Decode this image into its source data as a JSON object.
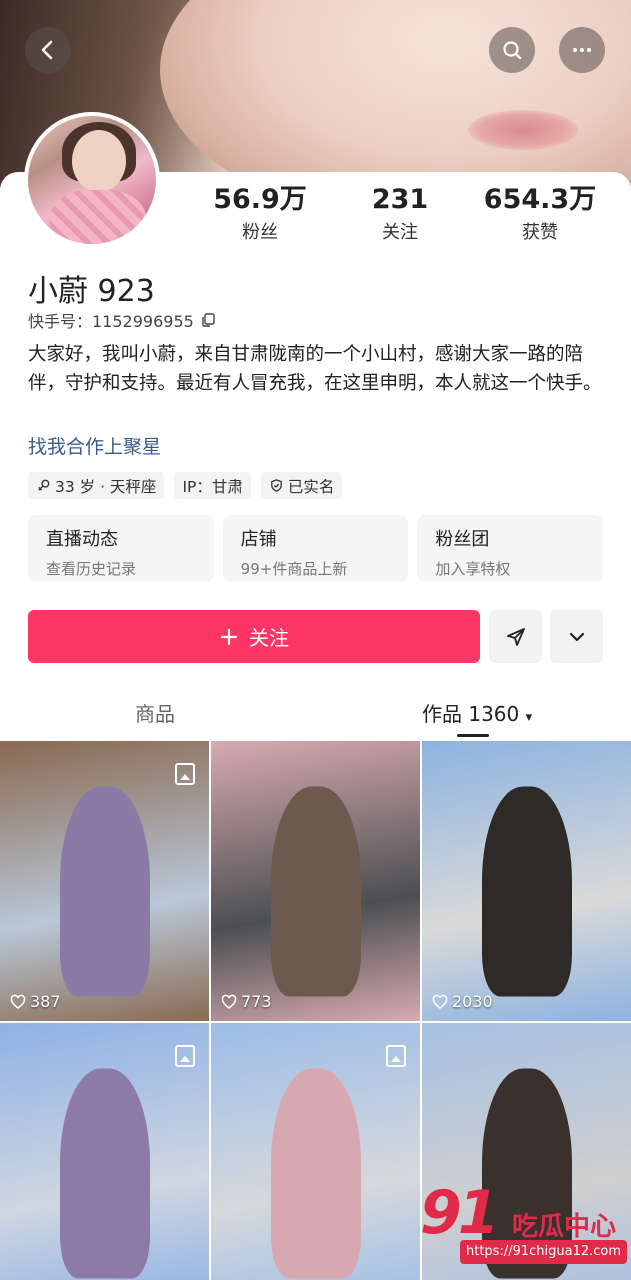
{
  "profile": {
    "stats": [
      {
        "num": "56.9万",
        "label": "粉丝"
      },
      {
        "num": "231",
        "label": "关注"
      },
      {
        "num": "654.3万",
        "label": "获赞"
      }
    ],
    "name": "小蔚 923",
    "uid_label": "快手号：1152996955",
    "bio": "大家好，我叫小蔚，来自甘肃陇南的一个小山村，感谢大家一路的陪伴，守护和支持。最近有人冒充我，在这里申明，本人就这一个快手。",
    "link": "找我合作上聚星",
    "tags": [
      "33 岁 · 天秤座",
      "IP：甘肃",
      "已实名"
    ]
  },
  "cards": [
    {
      "title": "直播动态",
      "sub": "查看历史记录"
    },
    {
      "title": "店铺",
      "sub": "99+件商品上新"
    },
    {
      "title": "粉丝团",
      "sub": "加入享特权"
    }
  ],
  "actions": {
    "follow_label": "关注"
  },
  "tabs": {
    "goods": "商品",
    "works": "作品 1360",
    "caret": "▾"
  },
  "posts": [
    {
      "likes": "387",
      "colors": [
        "#8a6a52",
        "#b9c7d8",
        "#8c7aa6"
      ]
    },
    {
      "likes": "773",
      "colors": [
        "#d7aab0",
        "#4c4f52",
        "#6b5a4d"
      ]
    },
    {
      "likes": "2030",
      "colors": [
        "#8db3e0",
        "#d9d9d9",
        "#2e2a28"
      ]
    },
    {
      "likes": "",
      "colors": [
        "#8fb1e6",
        "#cfd6e0",
        "#8d7aa8"
      ]
    },
    {
      "likes": "",
      "colors": [
        "#9cbde8",
        "#d6d8dc",
        "#d7a8b0"
      ]
    },
    {
      "likes": "",
      "colors": [
        "#a7c0e2",
        "#cfcfcf",
        "#3a302c"
      ]
    }
  ],
  "watermark": {
    "number": "91",
    "text": "吃瓜中心",
    "url": "https://91chigua12.com"
  }
}
